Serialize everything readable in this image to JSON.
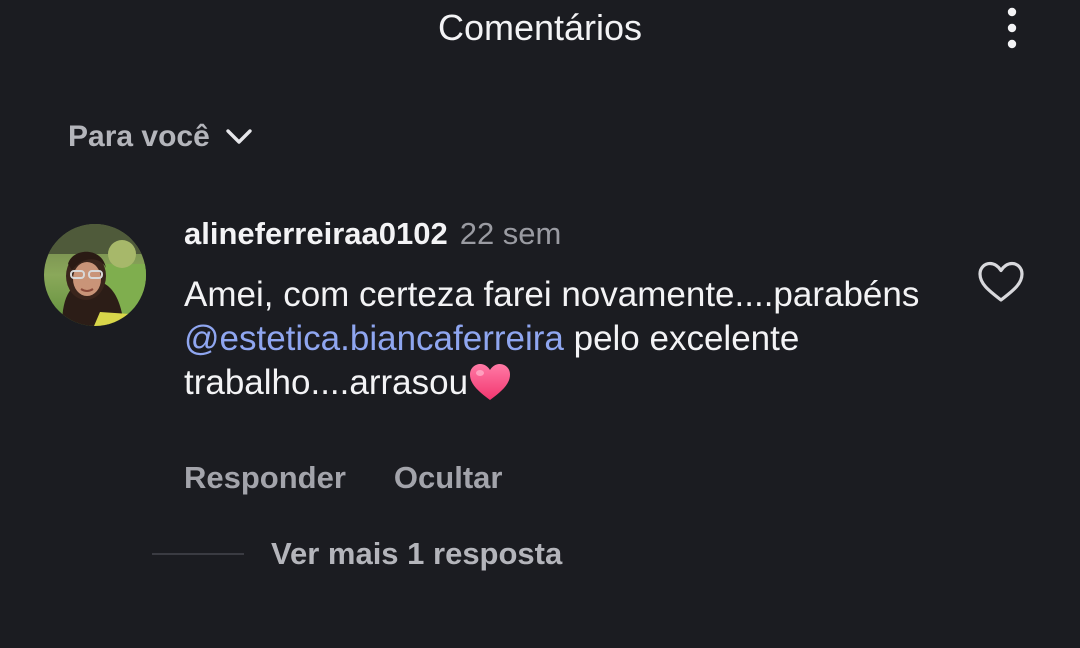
{
  "header": {
    "title": "Comentários",
    "more_icon": "vertical-ellipsis-icon"
  },
  "filter": {
    "label": "Para você",
    "icon": "chevron-down-icon"
  },
  "comment": {
    "username": "alineferreiraa0102",
    "timestamp": "22 sem",
    "text_before": "Amei, com certeza farei novamente....parabéns ",
    "mention": "@estetica.biancaferreira",
    "text_after": " pelo excelente trabalho....arrasou",
    "emoji": "pink-heart-emoji",
    "like_icon": "heart-outline-icon",
    "actions": {
      "reply": "Responder",
      "hide": "Ocultar"
    },
    "replies_label": "Ver mais 1 resposta"
  },
  "colors": {
    "background": "#1b1c21",
    "mention": "#8fa6f0",
    "secondary_text": "#a3a4ab"
  }
}
